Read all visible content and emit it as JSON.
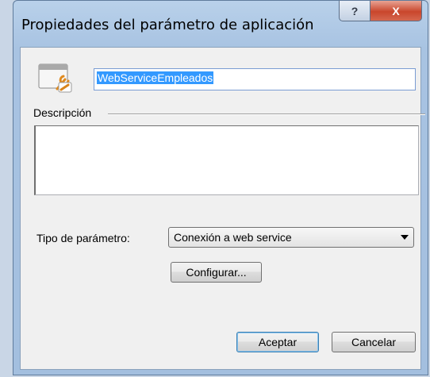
{
  "window": {
    "title": "Propiedades del parámetro de aplicación",
    "help_glyph": "?",
    "close_glyph": "X"
  },
  "form": {
    "name_value": "WebServiceEmpleados",
    "description_label": "Descripción",
    "description_value": "",
    "param_type_label": "Tipo de parámetro:",
    "param_type_selected": "Conexión a web service",
    "configure_label": "Configurar...",
    "accept_label": "Aceptar",
    "cancel_label": "Cancelar"
  },
  "icons": {
    "app_icon": "window-wrench-icon",
    "combo_arrow": "chevron-down-icon"
  }
}
